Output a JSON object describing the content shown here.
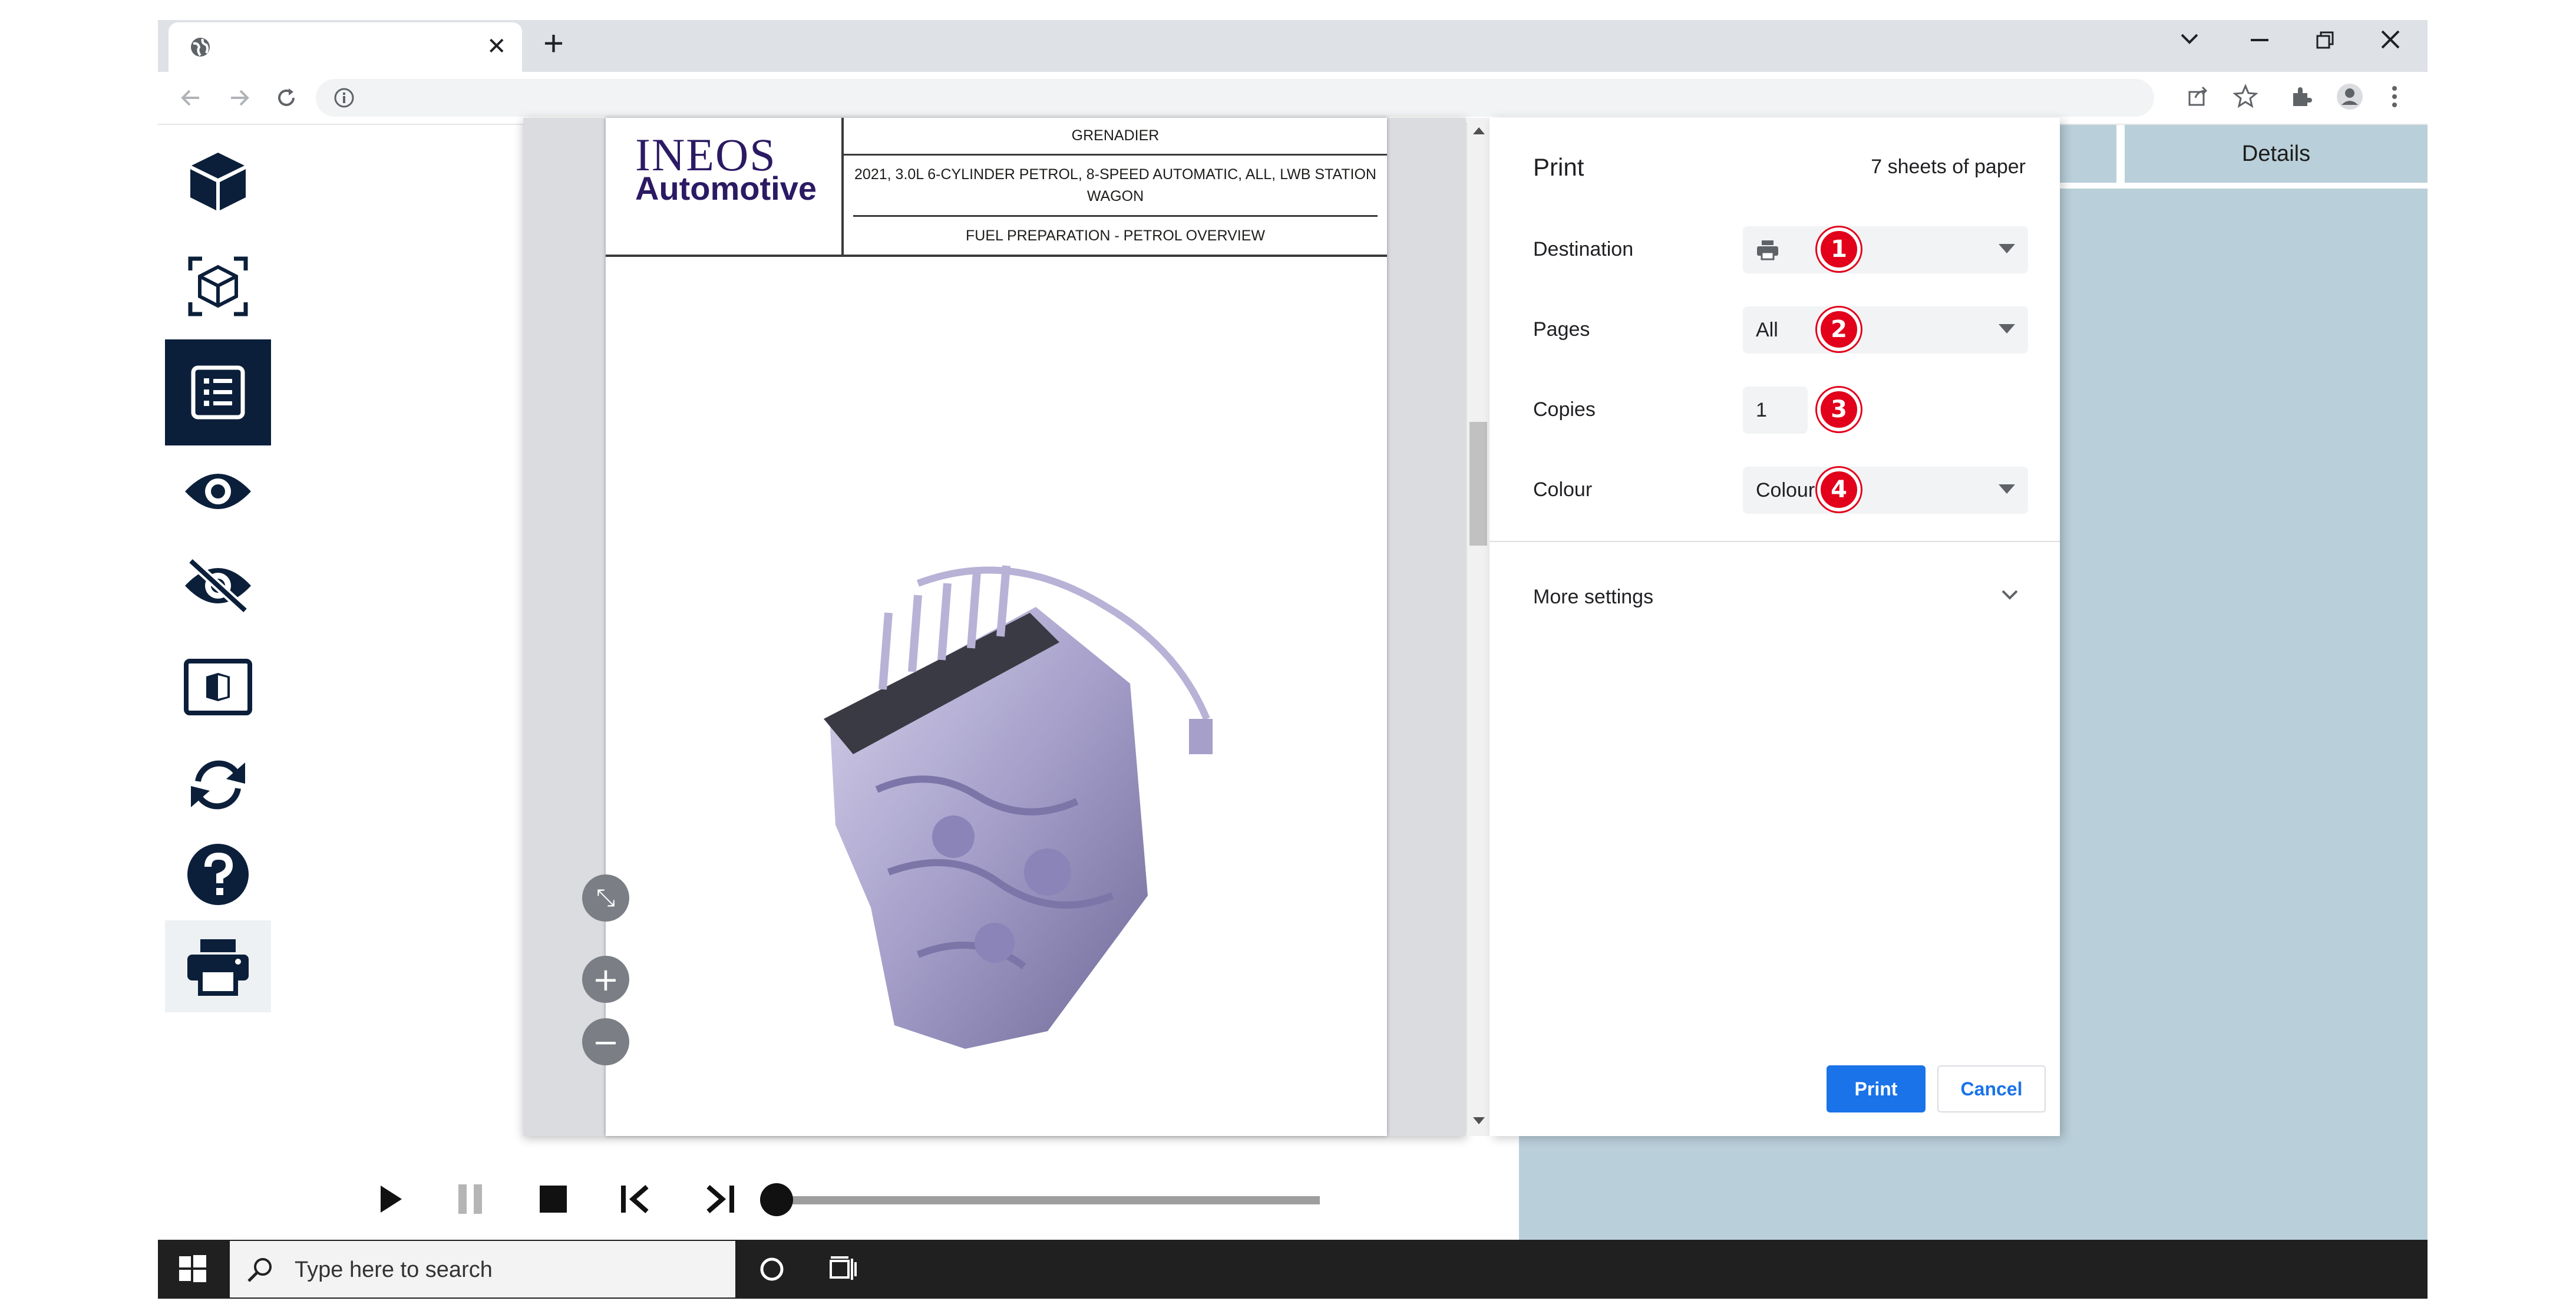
{
  "browser": {
    "tab_close": "✕",
    "new_tab": "+",
    "window_controls": [
      "chevron-down",
      "minimize",
      "restore",
      "close"
    ]
  },
  "app": {
    "header_tabs": [
      {
        "label": ""
      },
      {
        "label": "Details"
      }
    ],
    "sidebar_icons": [
      "cube-icon",
      "cube-select-icon",
      "list-icon",
      "eye-icon",
      "eye-off-icon",
      "contrast-icon",
      "refresh-icon",
      "help-icon",
      "print-icon"
    ],
    "playback": {
      "progress": 0.0
    }
  },
  "document": {
    "logo_line1": "INEOS",
    "logo_line2": "Automotive",
    "model": "GRENADIER",
    "spec": "2021, 3.0L 6-CYLINDER PETROL, 8-SPEED AUTOMATIC, ALL, LWB STATION WAGON",
    "section": "FUEL PREPARATION - PETROL OVERVIEW"
  },
  "print_dialog": {
    "title": "Print",
    "sheets": "7 sheets of paper",
    "destination_label": "Destination",
    "destination_value": "",
    "pages_label": "Pages",
    "pages_value": "All",
    "copies_label": "Copies",
    "copies_value": "1",
    "colour_label": "Colour",
    "colour_value": "Colour",
    "more_settings": "More settings",
    "print_button": "Print",
    "cancel_button": "Cancel",
    "badges": [
      "1",
      "2",
      "3",
      "4"
    ],
    "accent": "#1a73e8",
    "badge_color": "#e2001a"
  },
  "taskbar": {
    "search_placeholder": "Type here to search"
  },
  "colors": {
    "navy": "#0b1f3a",
    "panel": "#b9cfda"
  }
}
